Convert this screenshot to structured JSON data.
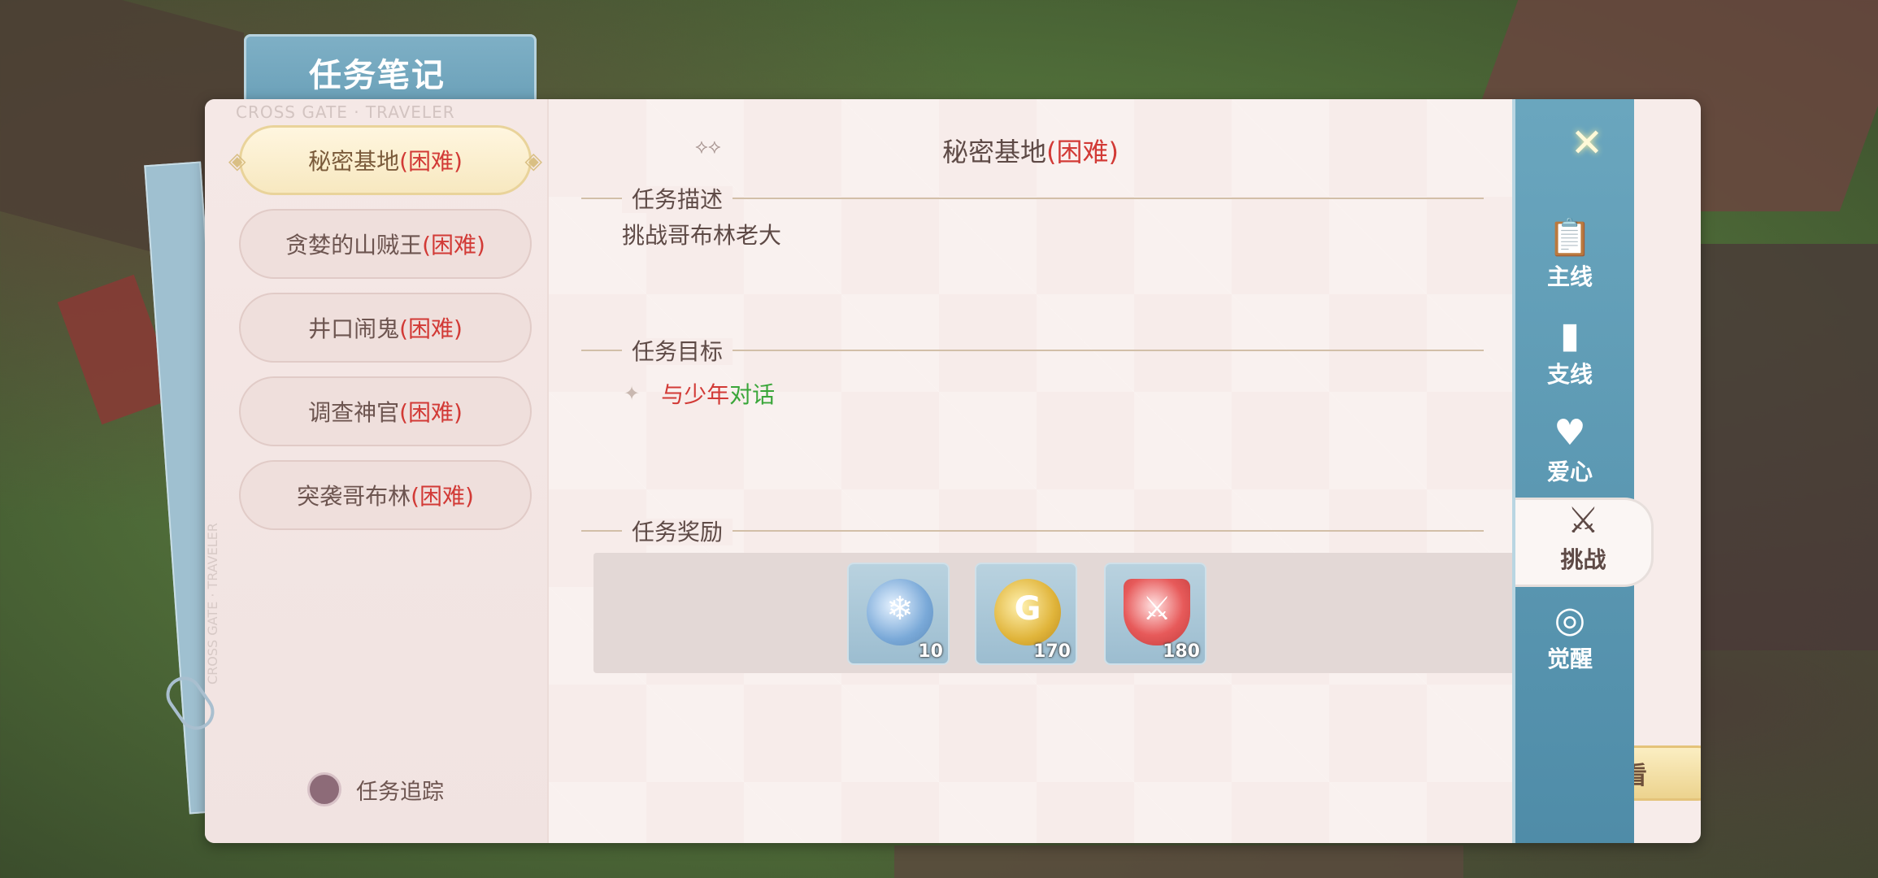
{
  "notebook": {
    "title": "任务笔记",
    "subtitle": "CROSS GATE · TRAVELER",
    "vertical_text": "CROSS GATE · TRAVELER"
  },
  "quest_list": [
    {
      "name": "秘密基地",
      "difficulty": "(困难)",
      "active": true
    },
    {
      "name": "贪婪的山贼王",
      "difficulty": "(困难)",
      "active": false
    },
    {
      "name": "井口闹鬼",
      "difficulty": "(困难)",
      "active": false
    },
    {
      "name": "调查神官",
      "difficulty": "(困难)",
      "active": false
    },
    {
      "name": "突袭哥布林",
      "difficulty": "(困难)",
      "active": false
    }
  ],
  "tracking": {
    "label": "任务追踪"
  },
  "detail": {
    "title_name": "秘密基地",
    "title_difficulty": "(困难)",
    "description_label": "任务描述",
    "description_text": "挑战哥布林老大",
    "goal_label": "任务目标",
    "goal_target": "与少年",
    "goal_action": "对话",
    "reward_label": "任务奖励",
    "rewards": [
      {
        "icon": "blue-medal-icon",
        "qty": "10"
      },
      {
        "icon": "gold-coin-icon",
        "qty": "170"
      },
      {
        "icon": "red-shield-icon",
        "qty": "180"
      }
    ],
    "view_button": "查看"
  },
  "side_nav": [
    {
      "label": "主线",
      "icon": "clipboard-icon"
    },
    {
      "label": "支线",
      "icon": "book-icon"
    },
    {
      "label": "爱心",
      "icon": "heart-icon"
    },
    {
      "label": "挑战",
      "icon": "crossed-swords-icon",
      "active": true
    },
    {
      "label": "觉醒",
      "icon": "awaken-orb-icon"
    }
  ],
  "colors": {
    "hard_red": "#d23a36",
    "goal_green": "#3aa63a",
    "nav_blue": "#5e9bb5",
    "button_gold": "#ecd38e"
  }
}
